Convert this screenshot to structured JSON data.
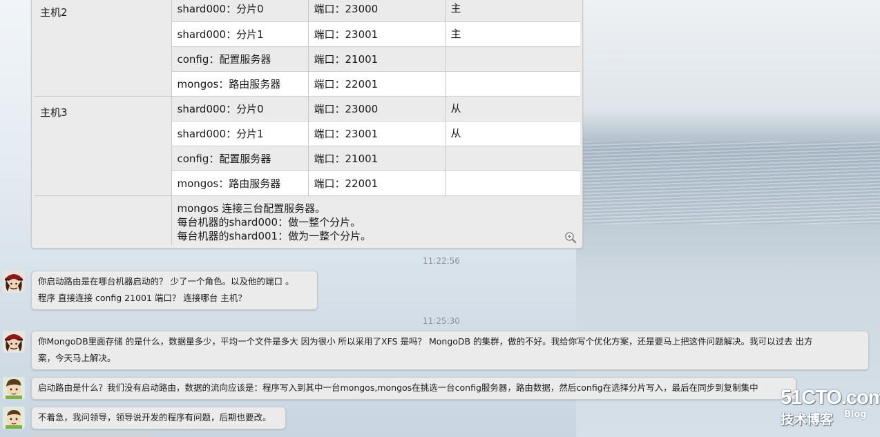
{
  "table": {
    "rows": [
      {
        "host": "主机2",
        "host_rowspan": 4,
        "service": "shard000：分片0",
        "port": "端口：23000",
        "role": "主",
        "shade": "alt"
      },
      {
        "service": "shard000：分片1",
        "port": "端口：23001",
        "role": "主",
        "shade": "wht"
      },
      {
        "service": "config：配置服务器",
        "port": "端口：21001",
        "role": "",
        "shade": "alt"
      },
      {
        "service": "mongos：路由服务器",
        "port": "端口：22001",
        "role": "",
        "shade": "wht"
      },
      {
        "host": "主机3",
        "host_rowspan": 4,
        "service": "shard000：分片0",
        "port": "端口：23000",
        "role": "从",
        "shade": "alt"
      },
      {
        "service": "shard000：分片1",
        "port": "端口：23001",
        "role": "从",
        "shade": "wht"
      },
      {
        "service": "config：配置服务器",
        "port": "端口：21001",
        "role": "",
        "shade": "alt"
      },
      {
        "service": "mongos：路由服务器",
        "port": "端口：22001",
        "role": "",
        "shade": "wht"
      }
    ],
    "note_lines": [
      "mongos 连接三台配置服务器。",
      "每台机器的shard000：做一整个分片。",
      "每台机器的shard001：做为一整个分片。"
    ],
    "zoom_icon": "zoom-in-icon"
  },
  "chat": {
    "timestamps": [
      "11:22:56",
      "11:25:30"
    ],
    "messages": [
      {
        "avatar": "pirate-avatar",
        "lines": [
          "你启动路由是在哪台机器启动的？ 少了一个角色。以及他的端口 。",
          "程序 直接连接 config  21001 端口？ 连接哪台 主机？"
        ]
      },
      {
        "avatar": "pirate-avatar",
        "lines": [
          "你MongoDB里面存储 的是什么，数据量多少，平均一个文件是多大      因为很小 所以采用了XFS 是吗？  MongoDB 的集群，做的不好。我给你写个优化方案，还是要马上把这件问题解决。我可以过去   出方",
          "案，今天马上解决。"
        ]
      },
      {
        "avatar": "boy-avatar",
        "lines": [
          "启动路由是什么？我们没有启动路由，数据的流向应该是：程序写入到其中一台mongos,mongos在挑选一台config服务器，路由数据，然后config在选择分片写入，最后在同步到复制集中"
        ]
      },
      {
        "avatar": "boy-avatar",
        "lines": [
          "不着急，我问领导，领导说开发的程序有问题，后期也要改。"
        ]
      }
    ]
  },
  "watermark": {
    "site": "51CTO.com",
    "tagline": "技术博客",
    "blog": "Blog"
  }
}
